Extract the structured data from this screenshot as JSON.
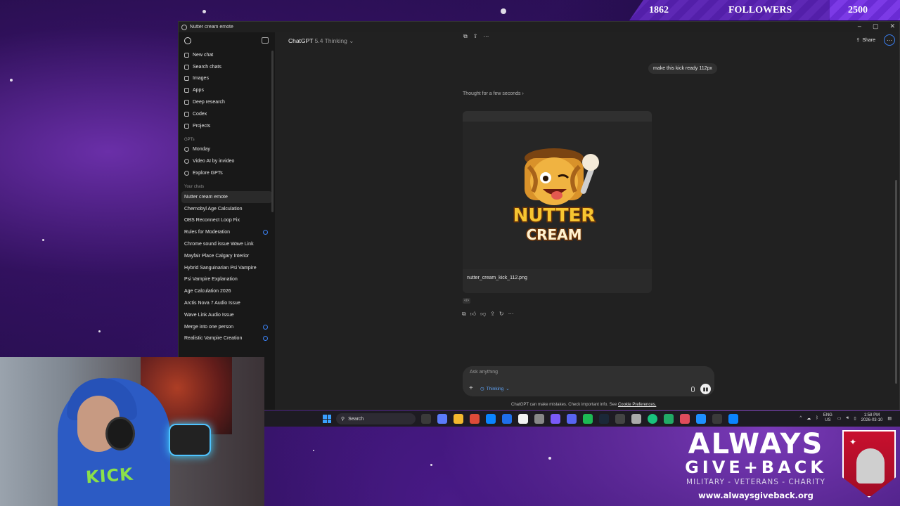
{
  "overlay": {
    "followers_current": "1862",
    "followers_label": "FOLLOWERS",
    "followers_goal": "2500",
    "followers_progress_fraction": 0.74
  },
  "window": {
    "title": "Nutter cream emote",
    "controls": [
      "–",
      "▢",
      "✕"
    ]
  },
  "sidebar": {
    "nav": [
      {
        "label": "New chat",
        "icon": "new-chat-icon"
      },
      {
        "label": "Search chats",
        "icon": "search-icon"
      },
      {
        "label": "Images",
        "icon": "image-icon"
      },
      {
        "label": "Apps",
        "icon": "apps-icon"
      },
      {
        "label": "Deep research",
        "icon": "deep-research-icon"
      },
      {
        "label": "Codex",
        "icon": "codex-icon"
      },
      {
        "label": "Projects",
        "icon": "folder-icon"
      }
    ],
    "gpts_heading": "GPTs",
    "gpts": [
      {
        "label": "Monday",
        "icon": "monday-gpt-icon"
      },
      {
        "label": "Video AI by invideo",
        "icon": "invideo-gpt-icon"
      },
      {
        "label": "Explore GPTs",
        "icon": "explore-gpts-icon"
      }
    ],
    "chats_heading": "Your chats",
    "chats": [
      {
        "label": "Nutter cream emote",
        "active": true,
        "dot": false
      },
      {
        "label": "Chernobyl Age Calculation",
        "active": false,
        "dot": false
      },
      {
        "label": "OBS Reconnect Loop Fix",
        "active": false,
        "dot": false
      },
      {
        "label": "Rules for Moderation",
        "active": false,
        "dot": true
      },
      {
        "label": "Chrome sound issue Wave Link",
        "active": false,
        "dot": false
      },
      {
        "label": "Mayfair Place Calgary Interior",
        "active": false,
        "dot": false
      },
      {
        "label": "Hybrid Sanguinarian Psi Vampire",
        "active": false,
        "dot": false
      },
      {
        "label": "Psi Vampire Explanation",
        "active": false,
        "dot": false
      },
      {
        "label": "Age Calculation 2026",
        "active": false,
        "dot": false
      },
      {
        "label": "Arctis Nova 7 Audio Issue",
        "active": false,
        "dot": false
      },
      {
        "label": "Wave Link Audio Issue",
        "active": false,
        "dot": false
      },
      {
        "label": "Merge into one person",
        "active": false,
        "dot": true
      },
      {
        "label": "Realistic Vampire Creation",
        "active": false,
        "dot": true
      }
    ]
  },
  "header": {
    "model_name": "ChatGPT",
    "model_version": "5.4 Thinking",
    "share_label": "Share"
  },
  "conversation": {
    "user_message": "make this kick ready 112px",
    "thought_label": "Thought for a few seconds",
    "image_filename": "nutter_cream_kick_112.png",
    "emote_text_line1": "NUTTER",
    "emote_text_line2": "CREAM",
    "code_badge": "</>"
  },
  "composer": {
    "placeholder": "Ask anything",
    "mode_label": "Thinking",
    "disclaimer": "ChatGPT can make mistakes. Check important info. See",
    "disclaimer_link": "Cookie Preferences."
  },
  "taskbar": {
    "search_label": "Search",
    "lang_line1": "ENG",
    "lang_line2": "US",
    "time": "1:58 PM",
    "date": "2026-03-10",
    "app_colors": [
      "#3a3a3a",
      "#5b7cfa",
      "#f3b82e",
      "#dd4b39",
      "#0a84ff",
      "#1f6feb",
      "#f2f2f2",
      "#888888",
      "#7a5af8",
      "#5865f2",
      "#1db954",
      "#1b2838",
      "#444444",
      "#aaaaaa",
      "#19c37d",
      "#22aa66",
      "#e04c5c",
      "#1e90ff",
      "#3a3a3a",
      "#0a84ff"
    ]
  },
  "branding": {
    "line1": "ALWAYS",
    "line2": "GIVE+BACK",
    "line3": "MILITARY - VETERANS - CHARITY",
    "url": "www.alwaysgiveback.org"
  },
  "webcam": {
    "shirt_text": "KICK"
  }
}
